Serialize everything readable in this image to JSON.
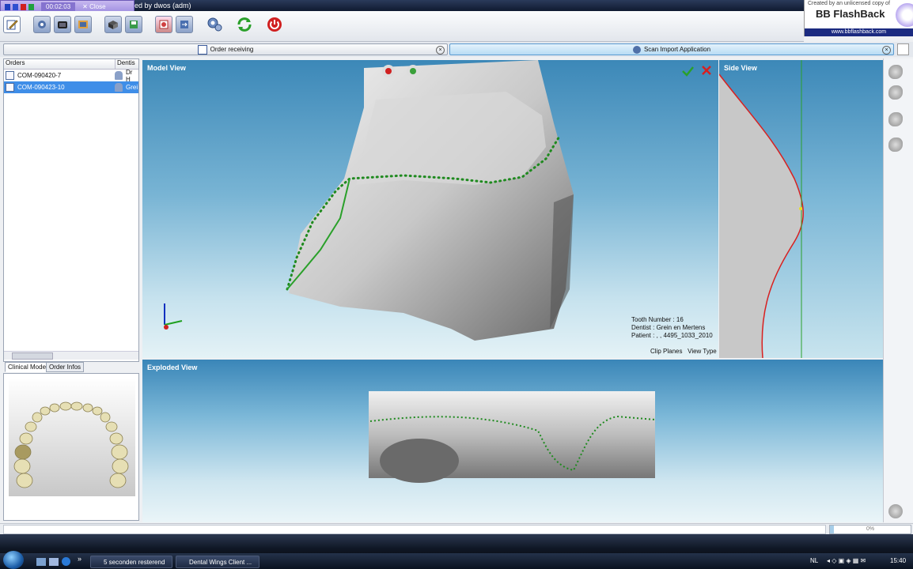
{
  "recorder": {
    "time": "00:02:03",
    "close_label": "Close"
  },
  "window": {
    "title": "ed by dwos  (adm)"
  },
  "watermark": {
    "top": "Created by an unlicensed copy of",
    "name": "BB FlashBack",
    "url": "www.bbflashback.com"
  },
  "toolbar": {
    "icons": [
      "edit-icon",
      "scanner-icon",
      "device-icon",
      "camera-icon",
      "box-icon",
      "save-icon",
      "report-icon",
      "export-icon",
      "settings-icon",
      "refresh-icon",
      "power-icon"
    ]
  },
  "tabs": [
    {
      "label": "Order receiving"
    },
    {
      "label": "Scan Import Application"
    }
  ],
  "orders": {
    "header": "Orders",
    "dentist_header": "Dentis",
    "rows": [
      {
        "id": "COM-090420-7",
        "dentist": "Dr H"
      },
      {
        "id": "COM-090423-10",
        "dentist": "Grei"
      }
    ]
  },
  "bottom_tabs": [
    {
      "label": "Clinical Model"
    },
    {
      "label": "Order Infos"
    }
  ],
  "model_view": {
    "title": "Model View",
    "tooth_number": "Tooth Number : 16",
    "dentist": "Dentist : Grein en Mertens",
    "patient": "Patient : , , 4495_1033_2010",
    "clip_planes": "Clip Planes",
    "view_type": "View Type"
  },
  "side_view": {
    "title": "Side View"
  },
  "exploded_view": {
    "title": "Exploded View"
  },
  "status": {
    "progress_text": "0%",
    "progress_value": 0.05
  },
  "taskbar": {
    "items": [
      {
        "label": "5 seconden resterend"
      },
      {
        "label": "Dental Wings Client ..."
      }
    ],
    "language": "NL",
    "time": "15:40"
  },
  "colors": {
    "accent": "#3f8ee8",
    "margin_line": "#2aa02a",
    "side_curve": "#d82020"
  }
}
